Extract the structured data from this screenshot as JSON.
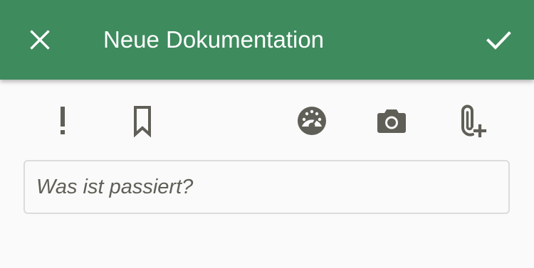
{
  "header": {
    "title": "Neue Dokumentation",
    "close_icon": "close-icon",
    "confirm_icon": "check-icon",
    "background": "#3e8b5e"
  },
  "toolbar": {
    "items": [
      {
        "name": "priority",
        "icon": "exclamation-icon"
      },
      {
        "name": "bookmark",
        "icon": "bookmark-icon"
      },
      {
        "name": "gauge",
        "icon": "speedometer-icon"
      },
      {
        "name": "camera",
        "icon": "camera-icon"
      },
      {
        "name": "attachment",
        "icon": "attach-add-icon"
      }
    ],
    "icon_color": "#5f5f57"
  },
  "form": {
    "what_happened": {
      "value": "",
      "placeholder": "Was ist passiert?"
    }
  }
}
